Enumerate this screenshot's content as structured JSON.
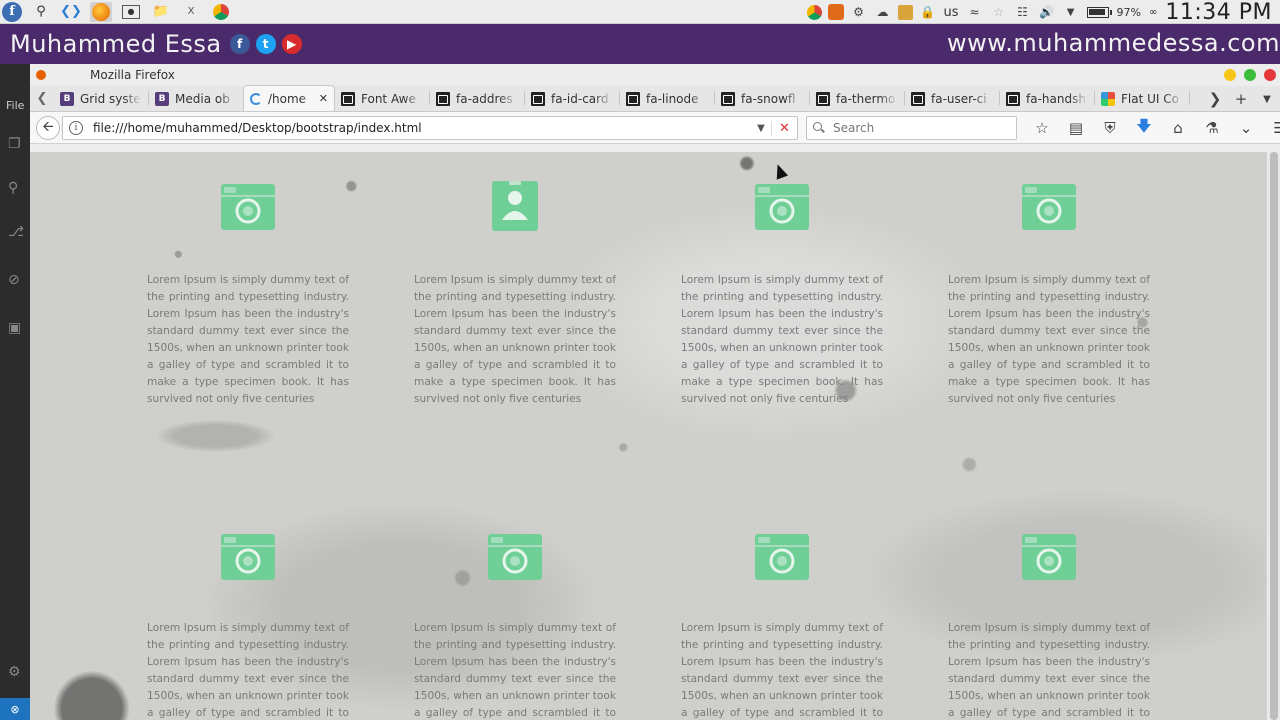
{
  "system_panel": {
    "tray_lang": "us",
    "battery": "97%",
    "clock": "11:34 PM"
  },
  "banner": {
    "name": "Muhammed Essa",
    "url": "www.muhammedessa.com"
  },
  "editor": {
    "menu_label": "File"
  },
  "browser": {
    "window_title": "Mozilla Firefox",
    "tabs": [
      {
        "label": "Grid syste",
        "favicon": "bootstrap",
        "active": false
      },
      {
        "label": "Media ob",
        "favicon": "bootstrap",
        "active": false
      },
      {
        "label": "/home",
        "favicon": "loading",
        "active": true
      },
      {
        "label": "Font Awe",
        "favicon": "fontawesome",
        "active": false
      },
      {
        "label": "fa-addres",
        "favicon": "fontawesome",
        "active": false
      },
      {
        "label": "fa-id-card",
        "favicon": "fontawesome",
        "active": false
      },
      {
        "label": "fa-linode",
        "favicon": "fontawesome",
        "active": false
      },
      {
        "label": "fa-snowfl",
        "favicon": "fontawesome",
        "active": false
      },
      {
        "label": "fa-thermo",
        "favicon": "fontawesome",
        "active": false
      },
      {
        "label": "fa-user-ci",
        "favicon": "fontawesome",
        "active": false
      },
      {
        "label": "fa-handsh",
        "favicon": "fontawesome",
        "active": false
      },
      {
        "label": "Flat UI Co",
        "favicon": "flatui",
        "active": false
      }
    ],
    "url": "file:///home/muhammed/Desktop/bootstrap/index.html",
    "search_placeholder": "Search"
  },
  "page": {
    "icon_color": "#6fcf97",
    "items": [
      {
        "icon": "camera-icon",
        "text": "Lorem Ipsum is simply dummy text of the printing and typesetting industry. Lorem Ipsum has been the industry's standard dummy text ever since the 1500s, when an unknown printer took a galley of type and scrambled it to make a type specimen book. It has survived not only five centuries"
      },
      {
        "icon": "user-card-icon",
        "text": "Lorem Ipsum is simply dummy text of the printing and typesetting industry. Lorem Ipsum has been the industry's standard dummy text ever since the 1500s, when an unknown printer took a galley of type and scrambled it to make a type specimen book. It has survived not only five centuries"
      },
      {
        "icon": "camera-icon",
        "text": "Lorem Ipsum is simply dummy text of the printing and typesetting industry. Lorem Ipsum has been the industry's standard dummy text ever since the 1500s, when an unknown printer took a galley of type and scrambled it to make a type specimen book. It has survived not only five centuries"
      },
      {
        "icon": "camera-icon",
        "text": "Lorem Ipsum is simply dummy text of the printing and typesetting industry. Lorem Ipsum has been the industry's standard dummy text ever since the 1500s, when an unknown printer took a galley of type and scrambled it to make a type specimen book. It has survived not only five centuries"
      },
      {
        "icon": "camera-icon",
        "text": "Lorem Ipsum is simply dummy text of the printing and typesetting industry. Lorem Ipsum has been the industry's standard dummy text ever since the 1500s, when an unknown printer took a galley of type and scrambled it to make"
      },
      {
        "icon": "camera-icon",
        "text": "Lorem Ipsum is simply dummy text of the printing and typesetting industry. Lorem Ipsum has been the industry's standard dummy text ever since the 1500s, when an unknown printer took a galley of type and scrambled it to make"
      },
      {
        "icon": "camera-icon",
        "text": "Lorem Ipsum is simply dummy text of the printing and typesetting industry. Lorem Ipsum has been the industry's standard dummy text ever since the 1500s, when an unknown printer took a galley of type and scrambled it to make"
      },
      {
        "icon": "camera-icon",
        "text": "Lorem Ipsum is simply dummy text of the printing and typesetting industry. Lorem Ipsum has been the industry's standard dummy text ever since the 1500s, when an unknown printer took a galley of type and scrambled it to make"
      }
    ]
  }
}
